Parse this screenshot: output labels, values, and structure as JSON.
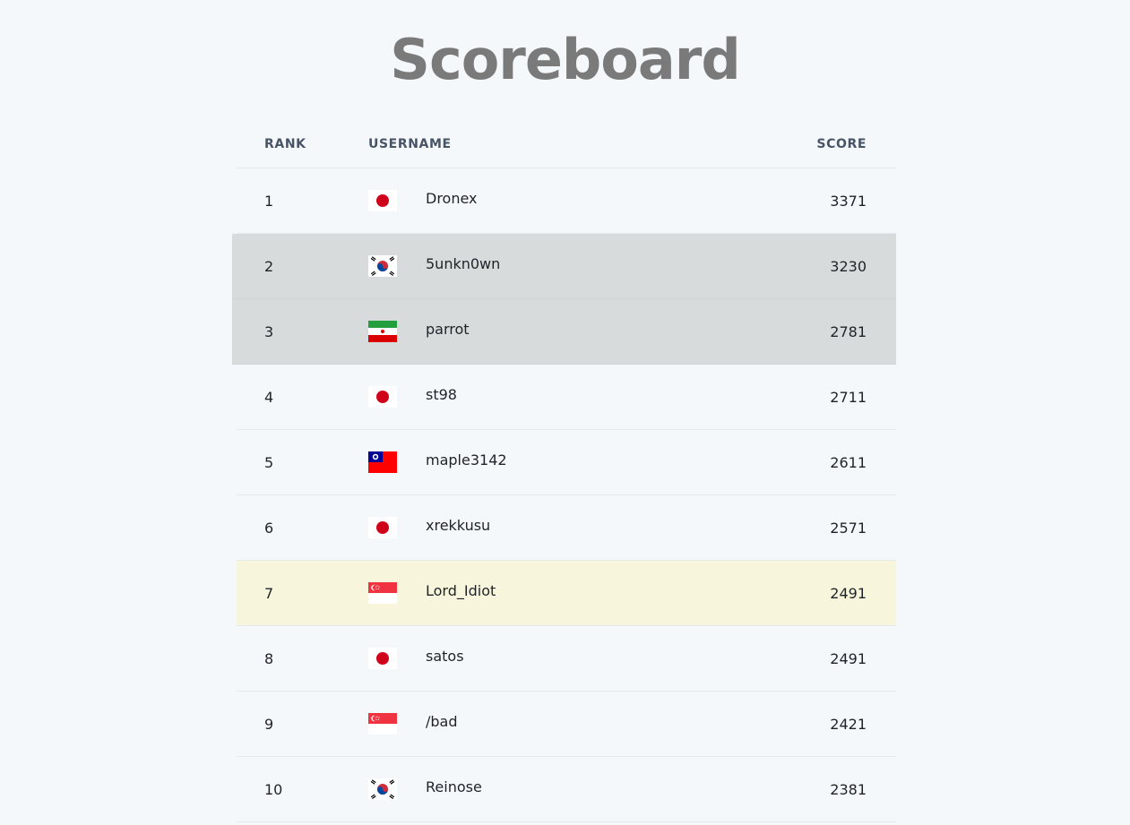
{
  "page": {
    "title": "Scoreboard"
  },
  "table": {
    "headers": {
      "rank": "RANK",
      "username": "USERNAME",
      "score": "SCORE"
    },
    "rows": [
      {
        "rank": "1",
        "username": "Dronex",
        "score": "3371",
        "flag": "japan-flag-icon"
      },
      {
        "rank": "2",
        "username": "5unkn0wn",
        "score": "3230",
        "flag": "south-korea-flag-icon"
      },
      {
        "rank": "3",
        "username": "parrot",
        "score": "2781",
        "flag": "iran-flag-icon"
      },
      {
        "rank": "4",
        "username": "st98",
        "score": "2711",
        "flag": "japan-flag-icon"
      },
      {
        "rank": "5",
        "username": "maple3142",
        "score": "2611",
        "flag": "taiwan-flag-icon"
      },
      {
        "rank": "6",
        "username": "xrekkusu",
        "score": "2571",
        "flag": "japan-flag-icon"
      },
      {
        "rank": "7",
        "username": "Lord_Idiot",
        "score": "2491",
        "flag": "singapore-flag-icon"
      },
      {
        "rank": "8",
        "username": "satos",
        "score": "2491",
        "flag": "japan-flag-icon"
      },
      {
        "rank": "9",
        "username": "/bad",
        "score": "2421",
        "flag": "singapore-flag-icon"
      },
      {
        "rank": "10",
        "username": "Reinose",
        "score": "2381",
        "flag": "south-korea-flag-icon"
      }
    ]
  },
  "colors": {
    "background": "#f5f8fb",
    "highlight_gray": "#d8dbdc",
    "highlight_yellow": "#f7f6dd",
    "title": "#7a7a7a"
  }
}
